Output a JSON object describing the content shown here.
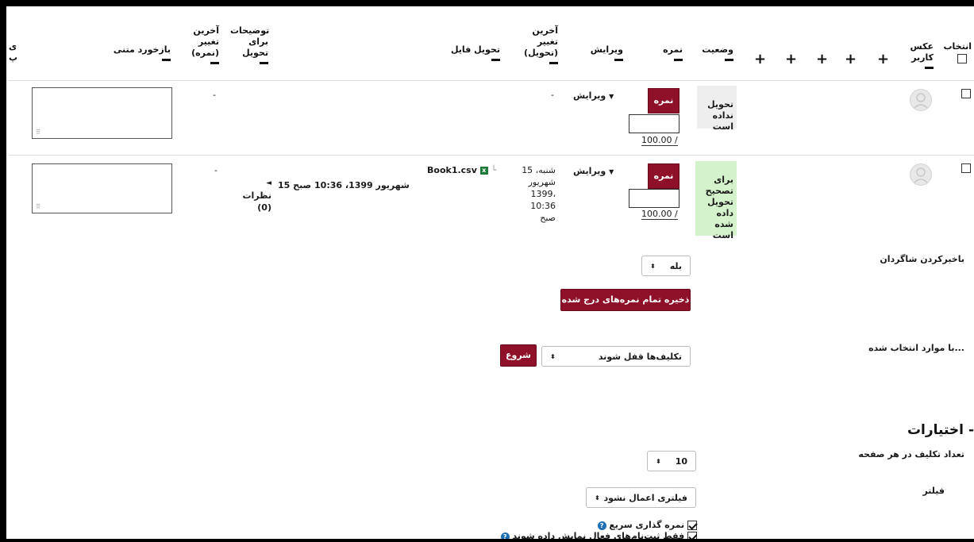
{
  "header": {
    "select": "انتخاب",
    "user_picture": "عکس\nکاربر",
    "status": "وضعیت",
    "grade": "نمره",
    "edit": "ویرایش",
    "last_modified_submission": "آخرین\nتغییر\n(تحویل)",
    "file_submissions": "تحویل فایل",
    "submission_comments": "توضیحات\nبرای\nتحویل",
    "last_modified_grade": "آخرین\nتغییر\n(نمره)",
    "feedback_comments": "بازخورد متنی",
    "cut_edge": "ی\nپ"
  },
  "rows": [
    {
      "status": "تحویل\nنداده\nاست",
      "status_color": "#eeeeee",
      "grade_button": "نمره",
      "grade_max": "100.00 /",
      "edit": "ویرایش",
      "last_modified_submission": "-",
      "file": "",
      "comments": "",
      "submission_date": "",
      "last_modified_grade": "-"
    },
    {
      "status": "برای\nتصحیح\nتحویل\nداده شده\nاست",
      "status_color": "#d4f2cc",
      "grade_button": "نمره",
      "grade_max": "100.00 /",
      "edit": "ویرایش",
      "last_modified_submission": "شنبه، 15\nشهریور\n1399،\n10:36\nصبح",
      "file": "Book1.csv",
      "comments": "نظرات\n(0)",
      "submission_date": "15 شهریور 1399، 10:36 صبح",
      "last_modified_grade": "-"
    }
  ],
  "notify": {
    "label": "باخبرکردن شاگردان",
    "value": "بله"
  },
  "save_button": "ذخیره تمام نمره‌های درج شده",
  "with_selected": {
    "label": "با موارد انتخاب شده...",
    "value": "تکلیف‌ها قفل شوند",
    "go": "شروع"
  },
  "options": {
    "title": "اختیارات",
    "per_page_label": "تعداد تکلیف در هر صفحه",
    "per_page_value": "10",
    "filter_label": "فیلتر",
    "filter_value": "فیلتری اعمال نشود",
    "quick_grading": "نمره گذاری سریع",
    "active_only": "فقط ثبت‌نام‌های فعال نمایش داده شوند"
  },
  "colors": {
    "accent": "#8f1029",
    "help": "#1f6fb5",
    "status_submitted": "#d4f2cc",
    "status_none": "#eeeeee"
  }
}
